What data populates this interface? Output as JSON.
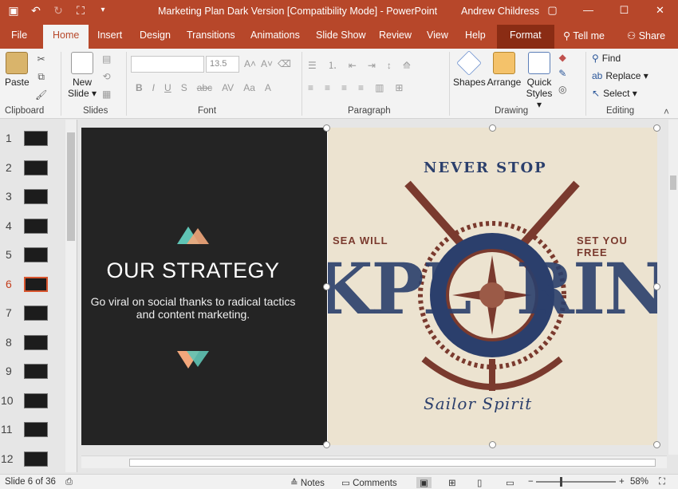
{
  "window": {
    "title": "Marketing Plan Dark Version [Compatibility Mode]  -  PowerPoint",
    "user": "Andrew Childress"
  },
  "tabs": [
    "File",
    "Home",
    "Insert",
    "Design",
    "Transitions",
    "Animations",
    "Slide Show",
    "Review",
    "View",
    "Help",
    "Format"
  ],
  "tell_me": "Tell me",
  "share": "Share",
  "ribbon": {
    "paste": "Paste",
    "new_slide_1": "New",
    "new_slide_2": "Slide",
    "font_size": "13.5",
    "shapes": "Shapes",
    "arrange": "Arrange",
    "quick_styles_1": "Quick",
    "quick_styles_2": "Styles",
    "find": "Find",
    "replace": "Replace",
    "select": "Select",
    "groups": {
      "clipboard": "Clipboard",
      "slides": "Slides",
      "font": "Font",
      "paragraph": "Paragraph",
      "drawing": "Drawing",
      "editing": "Editing"
    }
  },
  "thumbnails": [
    "1",
    "2",
    "3",
    "4",
    "5",
    "6",
    "7",
    "8",
    "9",
    "10",
    "11",
    "12"
  ],
  "slide": {
    "title_bold": "OUR",
    "title_light": "STRATEGY",
    "subtitle_1": "Go viral on social thanks to radical tactics",
    "subtitle_2": "and content marketing."
  },
  "picture": {
    "top_text": "NEVER STOP",
    "left_text": "SEA WILL",
    "right_text": "SET YOU FREE",
    "main_text": "KPL  RING",
    "bottom_text": "Sailor Spirit"
  },
  "status": {
    "slide_count": "Slide 6 of 36",
    "notes": "Notes",
    "comments": "Comments",
    "zoom": "58%"
  },
  "colors": {
    "accent": "#b7472a",
    "slide_dark": "#242424",
    "picture_bg": "#ece3d0",
    "navy": "#2b3f6c",
    "rust": "#7a3a2e"
  }
}
